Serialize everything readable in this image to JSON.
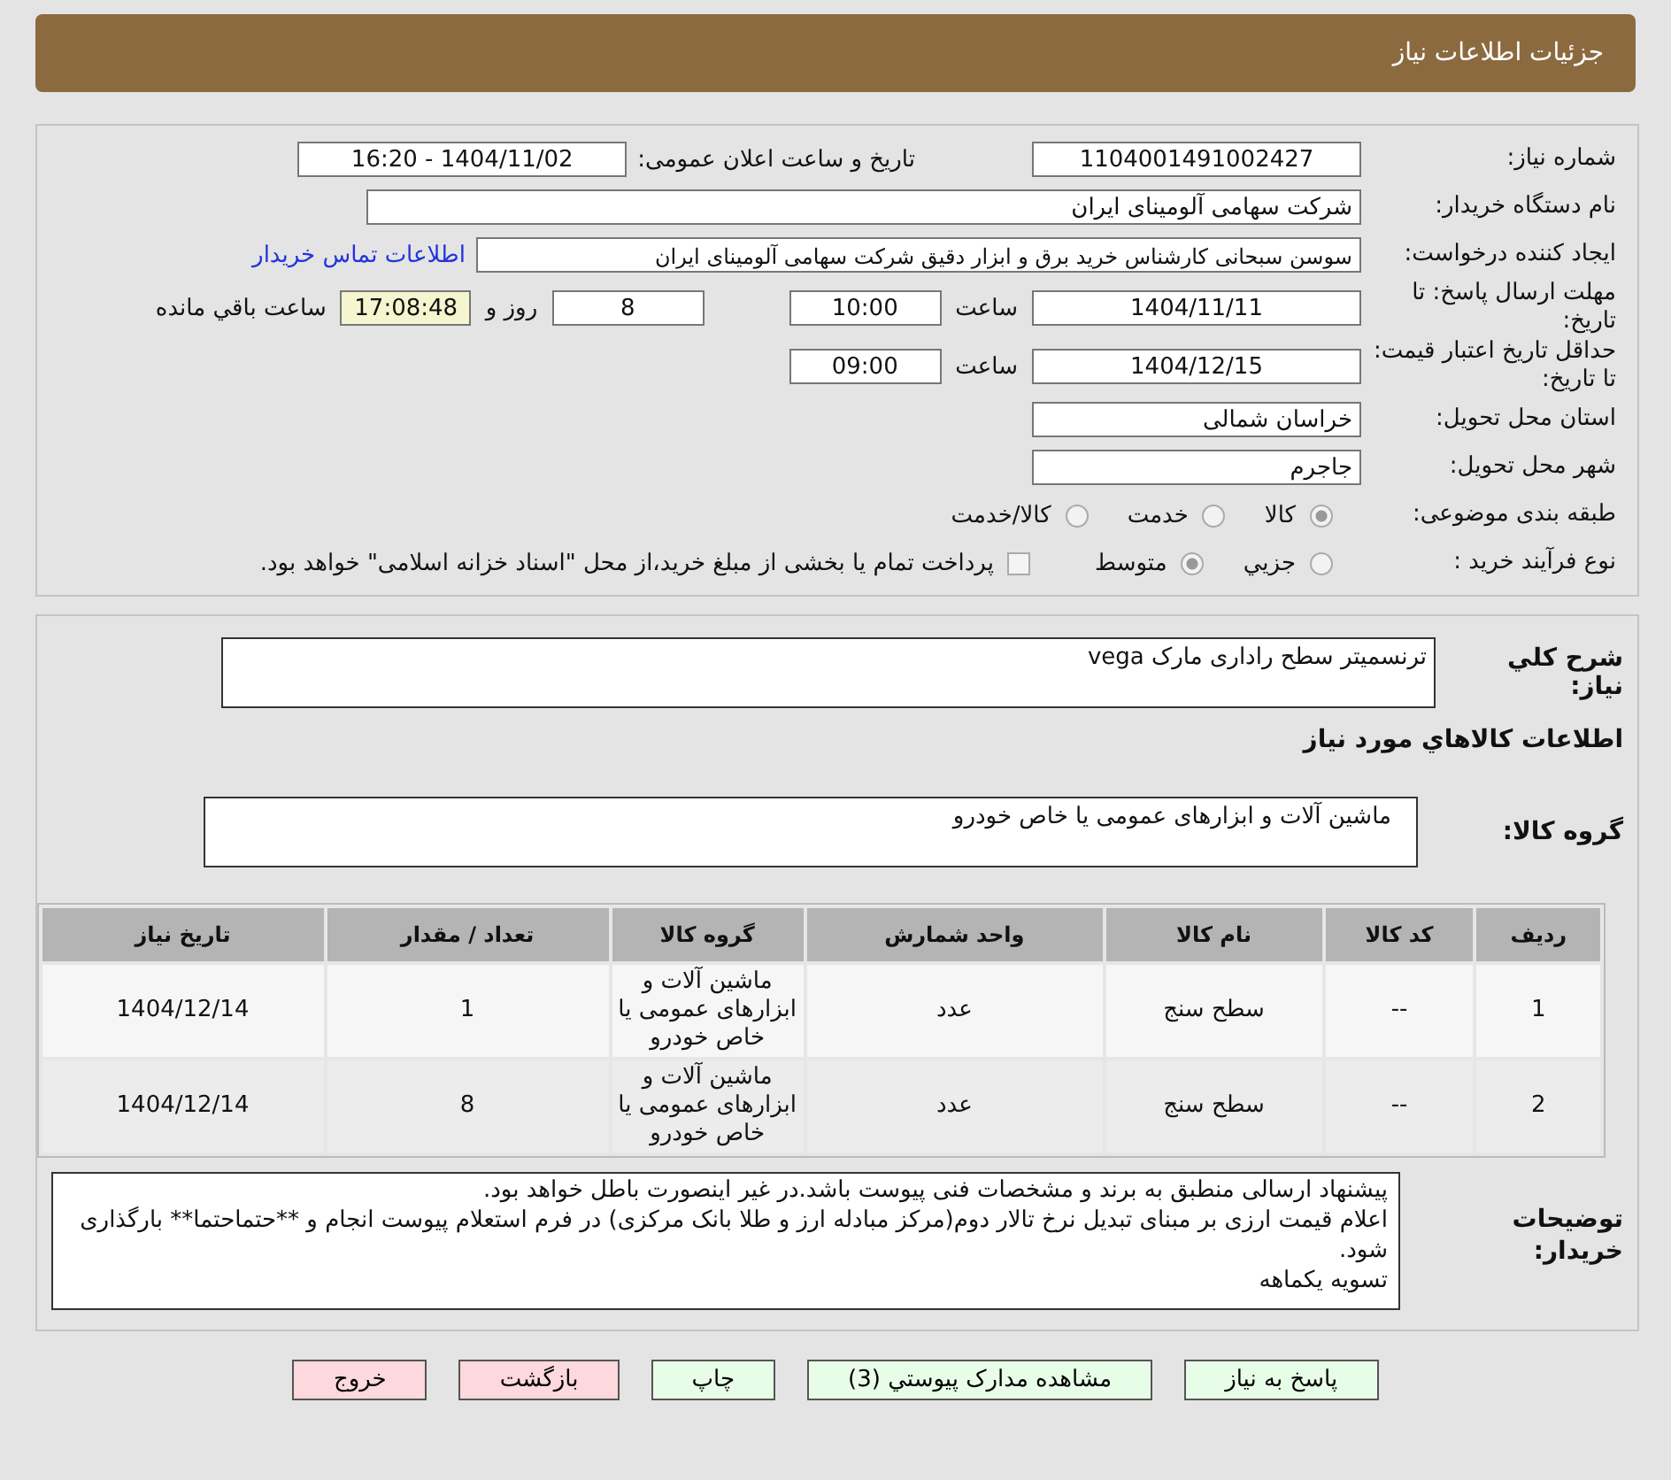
{
  "header": {
    "title": "جزئیات اطلاعات نیاز"
  },
  "need_number": {
    "label": "شماره نیاز:",
    "value": "1104001491002427"
  },
  "announce": {
    "label": "تاریخ و ساعت اعلان عمومی:",
    "value": "1404/11/02 - 16:20"
  },
  "buyer_org": {
    "label": "نام دستگاه خریدار:",
    "value": "شرکت سهامی آلومینای ایران"
  },
  "requester": {
    "label": "ایجاد کننده درخواست:",
    "value": "سوسن سبحانی کارشناس خرید برق و ابزار دقیق شرکت سهامی آلومینای ایران",
    "link": "اطلاعات تماس خریدار"
  },
  "deadline": {
    "label": "مهلت ارسال پاسخ: تا تاریخ:",
    "date": "1404/11/11",
    "time_label": "ساعت",
    "time": "10:00",
    "days": "8",
    "days_label": "روز و",
    "remaining": "17:08:48",
    "remaining_label": "ساعت باقي مانده"
  },
  "validity": {
    "label": "حداقل تاریخ اعتبار قیمت: تا تاریخ:",
    "date": "1404/12/15",
    "time_label": "ساعت",
    "time": "09:00"
  },
  "province": {
    "label": "استان محل تحویل:",
    "value": "خراسان شمالی"
  },
  "city": {
    "label": "شهر محل تحویل:",
    "value": "جاجرم"
  },
  "category": {
    "label": "طبقه بندی موضوعی:",
    "options": [
      {
        "label": "کالا",
        "selected": true
      },
      {
        "label": "خدمت",
        "selected": false
      },
      {
        "label": "کالا/خدمت",
        "selected": false
      }
    ]
  },
  "process": {
    "label": "نوع فرآیند خرید :",
    "options": [
      {
        "label": "جزيي",
        "selected": false
      },
      {
        "label": "متوسط",
        "selected": true
      }
    ],
    "treasury": {
      "label": "پرداخت تمام یا بخشی از مبلغ خرید،از محل \"اسناد خزانه اسلامی\" خواهد بود.",
      "checked": false
    }
  },
  "description": {
    "label": "شرح کلي نیاز:",
    "value": "ترنسمیتر سطح راداری مارک vega"
  },
  "goods_heading": "اطلاعات کالاهاي مورد نیاز",
  "goods_group": {
    "label": "گروه کالا:",
    "value": "ماشین آلات و ابزارهای عمومی یا خاص خودرو"
  },
  "table": {
    "columns": [
      "ردیف",
      "کد کالا",
      "نام کالا",
      "واحد شمارش",
      "گروه کالا",
      "تعداد / مقدار",
      "تاریخ نیاز"
    ],
    "rows": [
      [
        "1",
        "--",
        "سطح سنج",
        "عدد",
        "ماشین آلات و ابزارهای عمومی یا خاص خودرو",
        "1",
        "1404/12/14"
      ],
      [
        "2",
        "--",
        "سطح سنج",
        "عدد",
        "ماشین آلات و ابزارهای عمومی یا خاص خودرو",
        "8",
        "1404/12/14"
      ]
    ]
  },
  "buyer_notes": {
    "label": "توضیحات خریدار:",
    "lines": [
      "پیشنهاد ارسالی منطبق به برند و مشخصات فنی پیوست باشد.در غیر اینصورت باطل خواهد بود.",
      "اعلام قیمت ارزی بر مبنای تبدیل نرخ تالار دوم(مرکز مبادله ارز و طلا بانک مرکزی) در فرم استعلام پیوست انجام و **حتماحتما** بارگذاری شود.",
      "تسویه یکماهه"
    ]
  },
  "buttons": [
    {
      "label": "پاسخ به نیاز",
      "kind": "primary"
    },
    {
      "label": "مشاهده مدارک پیوستي (3)",
      "kind": "primary"
    },
    {
      "label": "چاپ",
      "kind": "primary"
    },
    {
      "label": "بازگشت",
      "kind": "danger"
    },
    {
      "label": "خروج",
      "kind": "danger"
    }
  ]
}
